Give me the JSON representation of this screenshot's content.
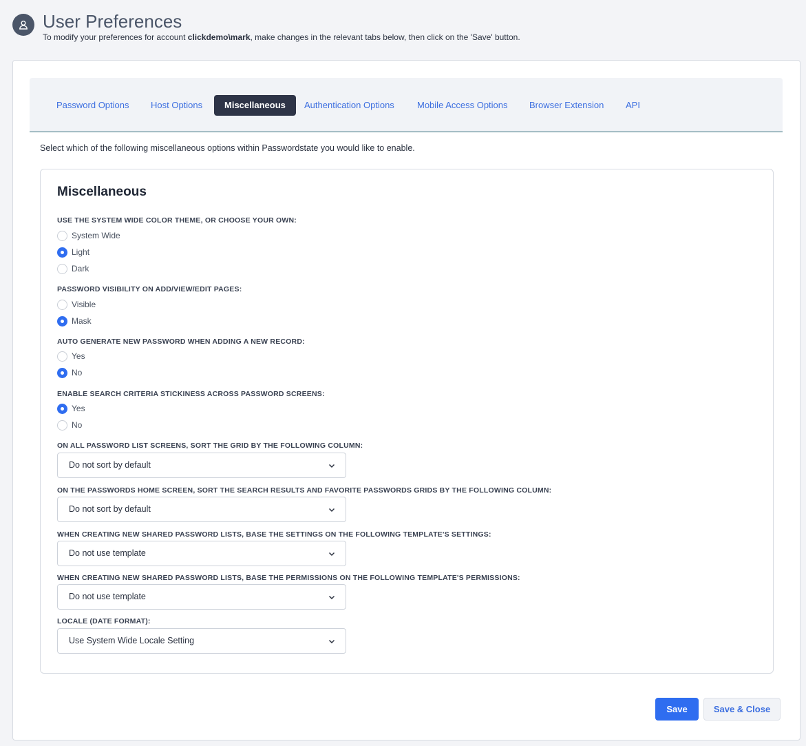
{
  "header": {
    "title": "User Preferences",
    "subtitle_pre": "To modify your preferences for account ",
    "account": "clickdemo\\mark",
    "subtitle_post": ", make changes in the relevant tabs below, then click on the 'Save' button."
  },
  "tabs": [
    {
      "label": "Password Options",
      "active": false
    },
    {
      "label": "Host Options",
      "active": false
    },
    {
      "label": "Miscellaneous",
      "active": true
    },
    {
      "label": "Authentication Options",
      "active": false
    },
    {
      "label": "Mobile Access Options",
      "active": false
    },
    {
      "label": "Browser Extension",
      "active": false
    },
    {
      "label": "API",
      "active": false
    }
  ],
  "intro": "Select which of the following miscellaneous options within Passwordstate you would like to enable.",
  "panel": {
    "title": "Miscellaneous",
    "color_theme": {
      "label": "USE THE SYSTEM WIDE COLOR THEME, OR CHOOSE YOUR OWN:",
      "options": [
        "System Wide",
        "Light",
        "Dark"
      ],
      "selected": "Light"
    },
    "password_visibility": {
      "label": "PASSWORD VISIBILITY ON ADD/VIEW/EDIT PAGES:",
      "options": [
        "Visible",
        "Mask"
      ],
      "selected": "Mask"
    },
    "auto_generate": {
      "label": "AUTO GENERATE NEW PASSWORD WHEN ADDING A NEW RECORD:",
      "options": [
        "Yes",
        "No"
      ],
      "selected": "No"
    },
    "search_stickiness": {
      "label": "ENABLE SEARCH CRITERIA STICKINESS ACROSS PASSWORD SCREENS:",
      "options": [
        "Yes",
        "No"
      ],
      "selected": "Yes"
    },
    "sort_list": {
      "label": "ON ALL PASSWORD LIST SCREENS, SORT THE GRID BY THE FOLLOWING COLUMN:",
      "value": "Do not sort by default"
    },
    "sort_home": {
      "label": "ON THE PASSWORDS HOME SCREEN, SORT THE SEARCH RESULTS AND FAVORITE PASSWORDS GRIDS BY THE FOLLOWING COLUMN:",
      "value": "Do not sort by default"
    },
    "template_settings": {
      "label": "WHEN CREATING NEW SHARED PASSWORD LISTS, BASE THE SETTINGS ON THE FOLLOWING TEMPLATE'S SETTINGS:",
      "value": "Do not use template"
    },
    "template_permissions": {
      "label": "WHEN CREATING NEW SHARED PASSWORD LISTS, BASE THE PERMISSIONS ON THE FOLLOWING TEMPLATE'S PERMISSIONS:",
      "value": "Do not use template"
    },
    "locale": {
      "label": "LOCALE (DATE FORMAT):",
      "value": "Use System Wide Locale Setting"
    }
  },
  "buttons": {
    "save": "Save",
    "save_close": "Save & Close"
  },
  "colors": {
    "accent": "#2f6df0",
    "tab_active_bg": "#2e3447",
    "link": "#3d6fe0"
  }
}
